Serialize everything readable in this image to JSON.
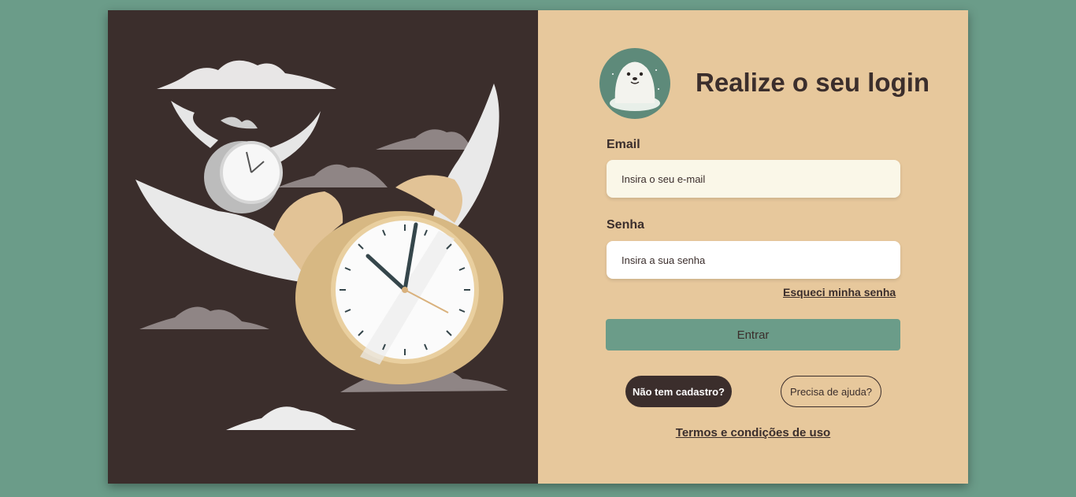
{
  "login": {
    "title": "Realize o seu login",
    "email_label": "Email",
    "email_placeholder": "Insira o seu e-mail",
    "password_label": "Senha",
    "password_placeholder": "Insira a sua senha",
    "forgot_link": "Esqueci minha senha",
    "submit_label": "Entrar",
    "signup_button": "Não tem cadastro?",
    "help_button": "Precisa de ajuda?",
    "terms_link": "Termos e condições de uso"
  },
  "illustration": {
    "subject": "flying-alarm-clocks",
    "icon": "seal-logo-icon"
  },
  "colors": {
    "page_background": "#6b9c89",
    "left_panel": "#3b2e2c",
    "right_panel": "#e7c89c",
    "accent_button": "#6b9c89",
    "text_dark": "#3b2e2c",
    "email_input_bg": "#faf7e8",
    "password_input_bg": "#ffffff"
  }
}
